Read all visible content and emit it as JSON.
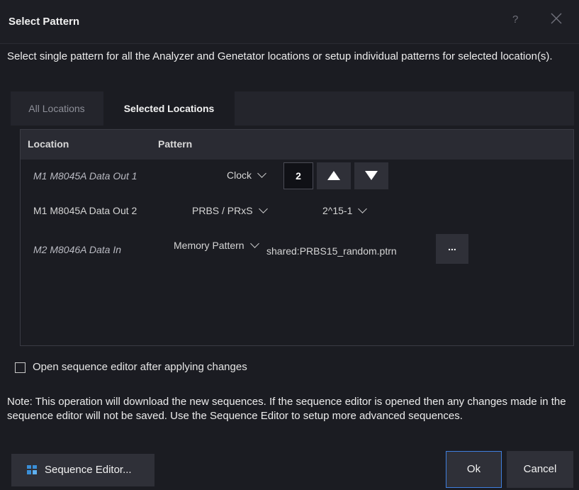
{
  "dialog": {
    "title": "Select Pattern",
    "help_label": "?",
    "description": "Select single pattern for all the Analyzer and Genetator locations or setup individual patterns for selected location(s)."
  },
  "tabs": [
    {
      "label": "All Locations",
      "selected": false
    },
    {
      "label": "Selected Locations",
      "selected": true
    }
  ],
  "table": {
    "headers": {
      "location": "Location",
      "pattern": "Pattern"
    },
    "rows": [
      {
        "location": "M1 M8045A Data Out 1",
        "pattern": "Clock",
        "value": "2"
      },
      {
        "location": "M1 M8045A Data Out 2",
        "pattern": "PRBS / PRxS",
        "value": "2^15-1"
      },
      {
        "location": "M2 M8046A Data In",
        "pattern": "Memory Pattern",
        "value": "shared:PRBS15_random.ptrn",
        "browse_label": "..."
      }
    ]
  },
  "option": {
    "label": "Open sequence editor after applying changes",
    "checked": false
  },
  "note": "Note: This operation will download the new sequences. If the sequence editor is opened then any changes made in the sequence editor will not be saved. Use the Sequence Editor to setup more advanced sequences.",
  "buttons": {
    "sequence_editor": "Sequence Editor...",
    "ok": "Ok",
    "cancel": "Cancel"
  },
  "icons": {
    "close": "close-icon",
    "up": "arrow-up-icon",
    "down": "arrow-down-icon",
    "dropdown": "chevron-down-icon",
    "sequence_editor": "sequence-editor-icon"
  },
  "colors": {
    "background": "#1b1c22",
    "panel_header": "#2a2b33",
    "button": "#2f3038",
    "focus_border": "#3f7fdf"
  }
}
